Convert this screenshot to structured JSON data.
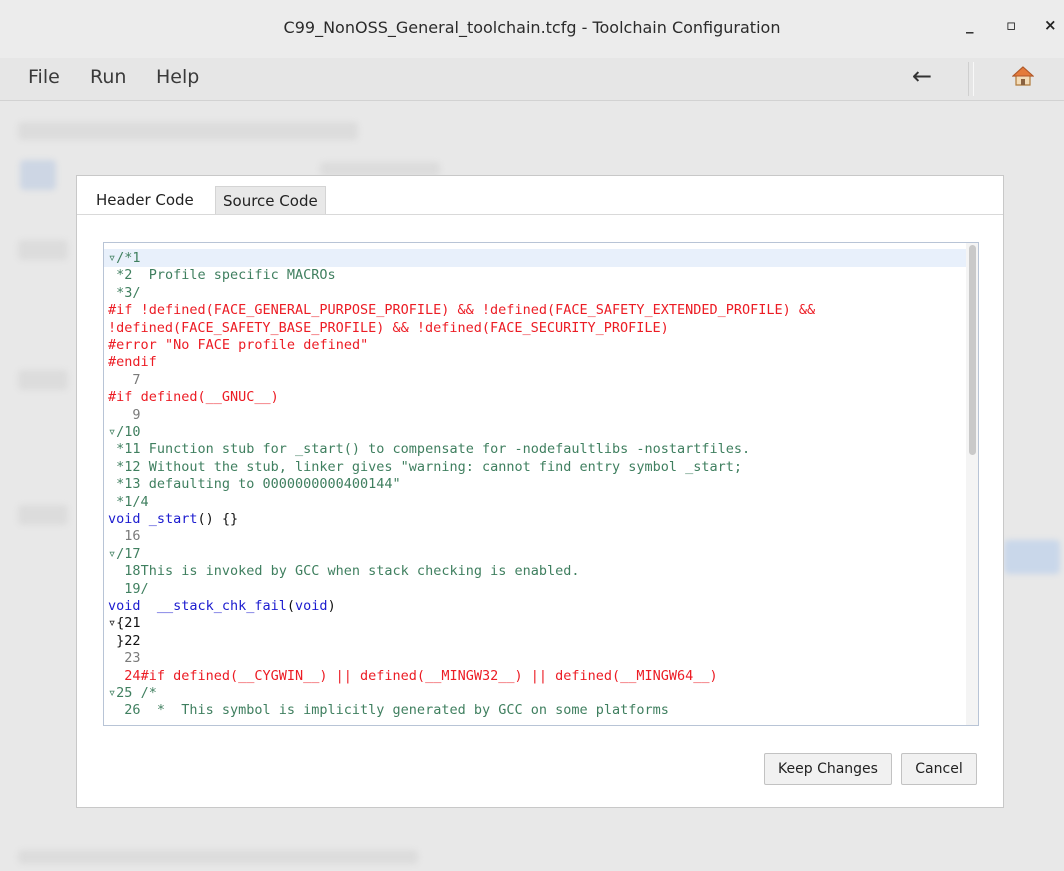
{
  "window": {
    "title": "C99_NonOSS_General_toolchain.tcfg - Toolchain Configuration",
    "minimize_glyph": "_",
    "maximize_glyph": "▫",
    "close_glyph": "×"
  },
  "menubar": {
    "items": [
      "File",
      "Run",
      "Help"
    ],
    "back_glyph": "←",
    "home_icon": "home-icon"
  },
  "dialog": {
    "tabs": [
      {
        "label": "Header Code",
        "selected": false
      },
      {
        "label": "Source Code",
        "selected": true
      }
    ],
    "editor": {
      "lines": [
        {
          "n": "▿/*1",
          "text": "",
          "color": "green"
        },
        {
          "n": " *2",
          "text": "  Profile specific MACROs",
          "color": "green"
        },
        {
          "n": " *3/",
          "text": "",
          "color": "green"
        },
        {
          "n": "#if",
          "text": " !defined(FACE_GENERAL_PURPOSE_PROFILE) && !defined(FACE_SAFETY_EXTENDED_PROFILE) &&",
          "color": "red"
        },
        {
          "n": "",
          "text": "!defined(FACE_SAFETY_BASE_PROFILE) && !defined(FACE_SECURITY_PROFILE)",
          "color": "red"
        },
        {
          "n": "#error",
          "text": " \"No FACE profile defined\"",
          "color": "red"
        },
        {
          "n": "#endif",
          "text": "",
          "color": "red"
        },
        {
          "n": "   7",
          "text": "",
          "color": "gray"
        },
        {
          "n": "#if",
          "text": " defined(__GNUC__)",
          "color": "red"
        },
        {
          "n": "   9",
          "text": "",
          "color": "gray"
        },
        {
          "n": "▿/10",
          "text": "",
          "color": "green"
        },
        {
          "n": " *11",
          "text": " Function stub for _start() to compensate for -nodefaultlibs -nostartfiles.",
          "color": "green"
        },
        {
          "n": " *12",
          "text": " Without the stub, linker gives \"warning: cannot find entry symbol _start;",
          "color": "green"
        },
        {
          "n": " *13",
          "text": " defaulting to 0000000000400144\"",
          "color": "green"
        },
        {
          "n": " *1/4",
          "text": "",
          "color": "green"
        },
        {
          "n": "void",
          "text": " _start() {}",
          "color": "blue"
        },
        {
          "n": "  16",
          "text": "",
          "color": "gray"
        },
        {
          "n": "▿/17",
          "text": "",
          "color": "green"
        },
        {
          "n": "  18",
          "text": "This is invoked by GCC when stack checking is enabled.",
          "color": "green"
        },
        {
          "n": "  19/",
          "text": "",
          "color": "green"
        },
        {
          "n": "void",
          "text": "  __stack_chk_fail(void)",
          "color": "blue"
        },
        {
          "n": "▿{21",
          "text": "",
          "color": "black"
        },
        {
          "n": " }22",
          "text": "",
          "color": "black"
        },
        {
          "n": "  23",
          "text": "",
          "color": "gray"
        },
        {
          "n": "  24",
          "text": "#if defined(__CYGWIN__) || defined(__MINGW32__) || defined(__MINGW64__)",
          "color": "red"
        },
        {
          "n": "▿25",
          "text": " /*",
          "color": "green"
        },
        {
          "n": "  26",
          "text": "  *  This symbol is implicitly generated by GCC on some platforms",
          "color": "green"
        }
      ]
    },
    "buttons": {
      "keep": "Keep Changes",
      "cancel": "Cancel"
    }
  },
  "colors": {
    "comment": "#3f7f5f",
    "preprocessor": "#ec1c24",
    "keyword": "#1b1bcf",
    "line_number": "#7a7a7a"
  }
}
